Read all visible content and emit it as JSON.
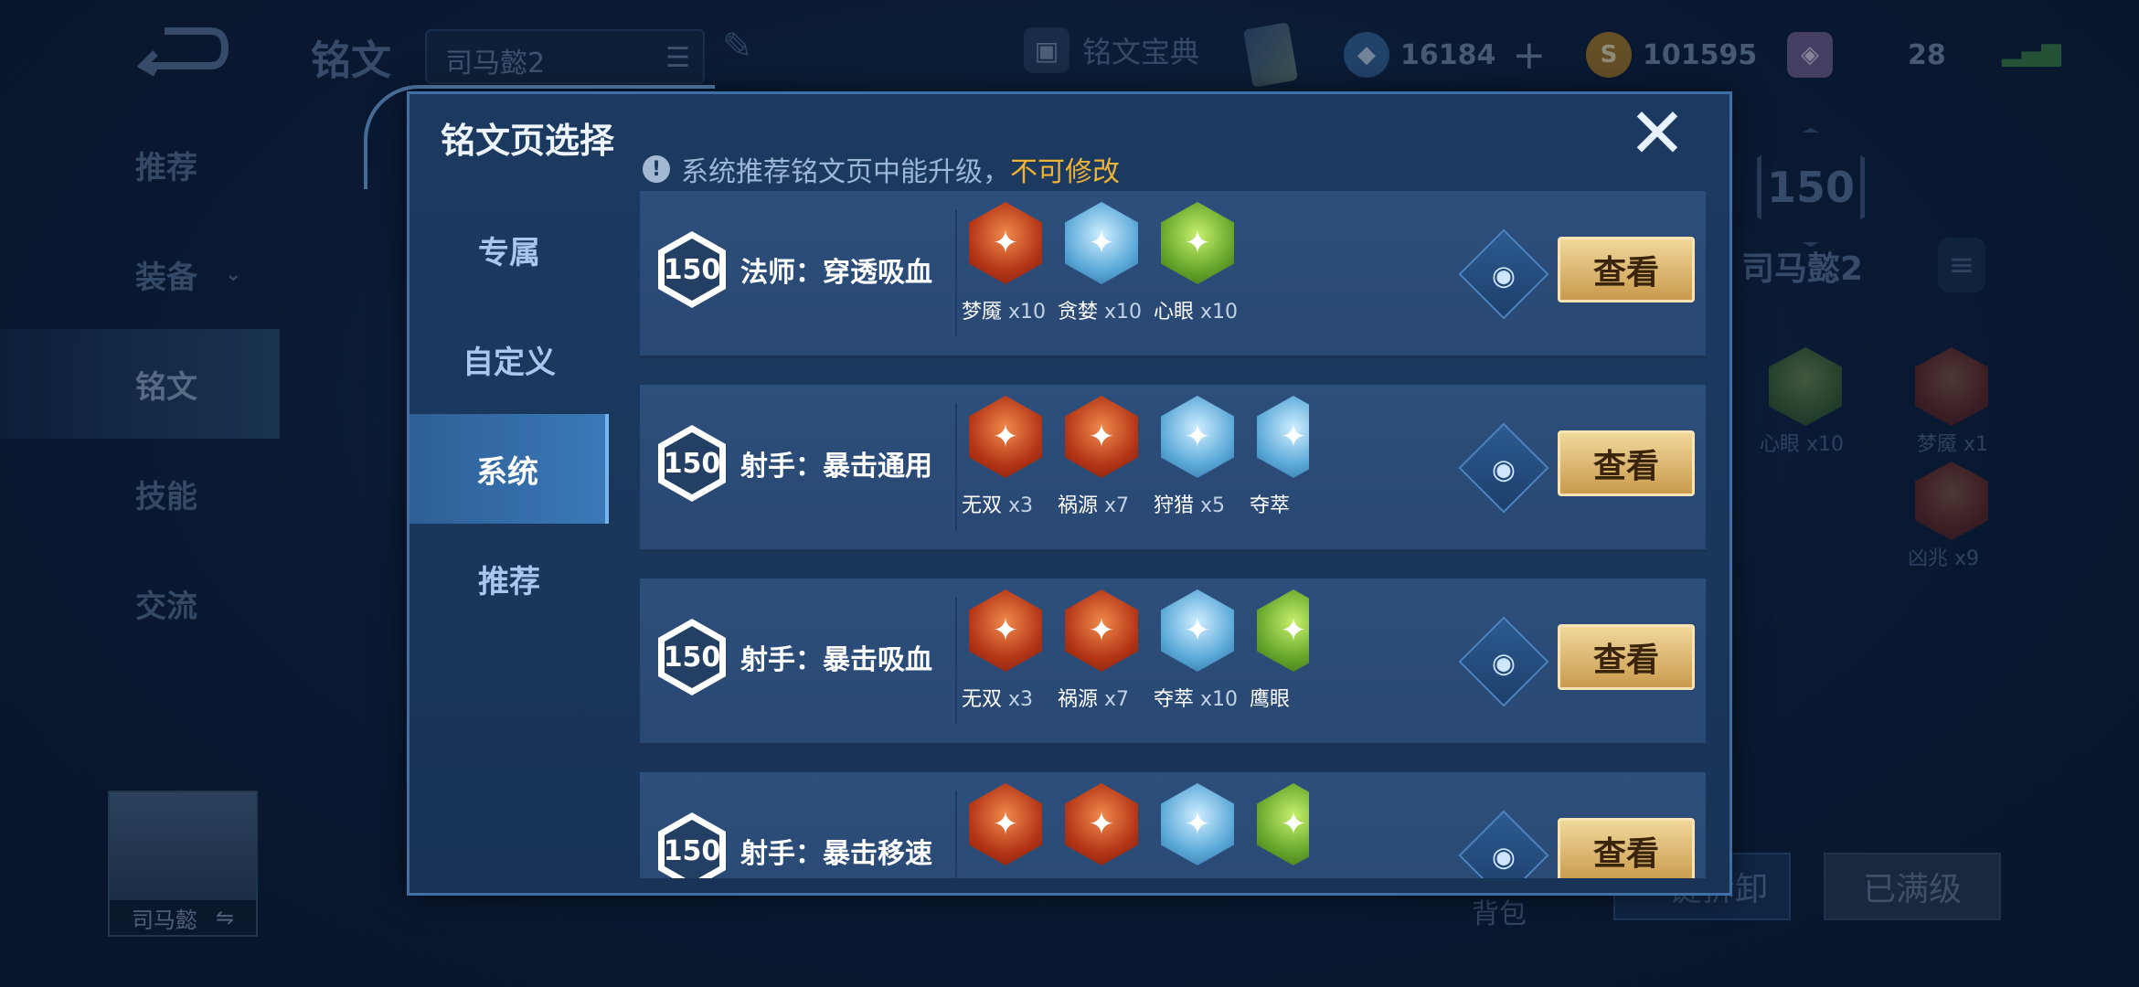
{
  "background": {
    "page_title": "铭文",
    "page_select": "司马懿2",
    "codex_label": "铭文宝典",
    "currency1": "16184",
    "currency2": "101595",
    "currency3": "28",
    "left_nav": [
      "推荐",
      "装备",
      "铭文",
      "技能",
      "交流"
    ],
    "hero_name": "司马懿",
    "rune_page_level": "150",
    "rune_page_name": "司马懿2",
    "bg_runes": [
      {
        "label": "心眼 x10"
      },
      {
        "label": "梦魇 x1"
      },
      {
        "label": "凶兆 x9"
      }
    ],
    "bag_label": "背包",
    "unload_label": "一键拆卸",
    "maxed_label": "已满级"
  },
  "modal": {
    "title": "铭文页选择",
    "close": "✕",
    "notice": "系统推荐铭文页中能升级，",
    "notice_warn": "不可修改",
    "tabs": [
      "专属",
      "自定义",
      "系统",
      "推荐"
    ],
    "active_tab": "系统",
    "rows": [
      {
        "level": "150",
        "name": "法师：穿透吸血",
        "view": "查看",
        "runes": [
          {
            "name": "梦魇",
            "count": "x10",
            "color": "red"
          },
          {
            "name": "贪婪",
            "count": "x10",
            "color": "blue"
          },
          {
            "name": "心眼",
            "count": "x10",
            "color": "green"
          }
        ]
      },
      {
        "level": "150",
        "name": "射手：暴击通用",
        "view": "查看",
        "runes": [
          {
            "name": "无双",
            "count": "x3",
            "color": "red"
          },
          {
            "name": "祸源",
            "count": "x7",
            "color": "red"
          },
          {
            "name": "狩猎",
            "count": "x5",
            "color": "blue"
          },
          {
            "name": "夺萃",
            "count": "",
            "color": "blue"
          }
        ]
      },
      {
        "level": "150",
        "name": "射手：暴击吸血",
        "view": "查看",
        "runes": [
          {
            "name": "无双",
            "count": "x3",
            "color": "red"
          },
          {
            "name": "祸源",
            "count": "x7",
            "color": "red"
          },
          {
            "name": "夺萃",
            "count": "x10",
            "color": "blue"
          },
          {
            "name": "鹰眼",
            "count": "",
            "color": "green"
          }
        ]
      },
      {
        "level": "150",
        "name": "射手：暴击移速",
        "view": "查看",
        "runes": [
          {
            "name": "",
            "count": "",
            "color": "red"
          },
          {
            "name": "",
            "count": "",
            "color": "red"
          },
          {
            "name": "",
            "count": "",
            "color": "blue"
          },
          {
            "name": "",
            "count": "",
            "color": "green"
          }
        ]
      }
    ]
  },
  "icons": {
    "back": "back-arrow-icon",
    "list": "list-icon",
    "edit": "brush-icon",
    "codex": "book-icon",
    "plus": "plus-icon",
    "signal": "signal-icon",
    "notice": "exclamation-icon",
    "eye": "eye-icon",
    "close": "close-icon",
    "swap": "swap-icon",
    "menu": "menu-icon"
  }
}
